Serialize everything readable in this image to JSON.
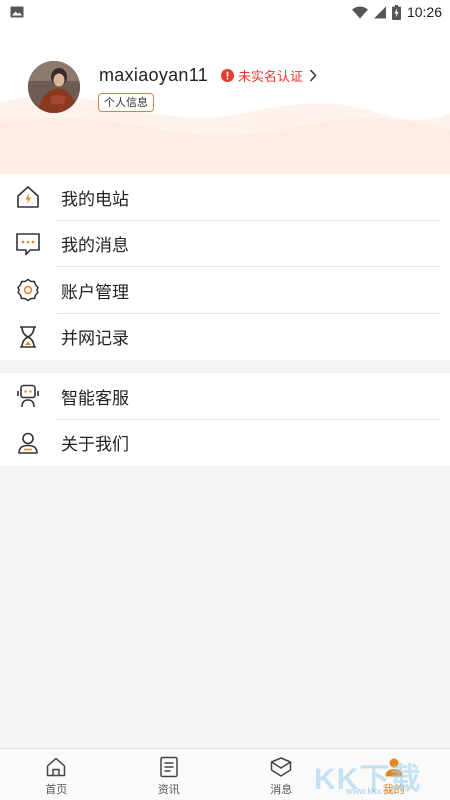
{
  "status_bar": {
    "time": "10:26",
    "left_icon": "image-icon",
    "icons": [
      "wifi-icon",
      "signal-icon",
      "battery-icon"
    ]
  },
  "profile": {
    "username": "maxiaoyan11",
    "verify_status": "未实名认证",
    "info_badge": "个人信息",
    "avatar": "avatar-photo"
  },
  "menu": {
    "group1": [
      {
        "label": "我的电站",
        "icon": "home-power-icon"
      },
      {
        "label": "我的消息",
        "icon": "message-icon"
      },
      {
        "label": "账户管理",
        "icon": "account-settings-icon"
      },
      {
        "label": "并网记录",
        "icon": "hourglass-icon"
      }
    ],
    "group2": [
      {
        "label": "智能客服",
        "icon": "robot-service-icon"
      },
      {
        "label": "关于我们",
        "icon": "user-icon"
      }
    ]
  },
  "tab_bar": [
    {
      "label": "首页",
      "icon": "home-icon",
      "active": false
    },
    {
      "label": "资讯",
      "icon": "news-icon",
      "active": false
    },
    {
      "label": "消息",
      "icon": "message-tab-icon",
      "active": false
    },
    {
      "label": "我的",
      "icon": "profile-icon",
      "active": true
    }
  ],
  "watermark": {
    "main": "KK下载",
    "sub": "www.kkx.net"
  },
  "colors": {
    "accent": "#e8861e",
    "warning": "#e63b2e",
    "background": "#f4f4f4"
  }
}
